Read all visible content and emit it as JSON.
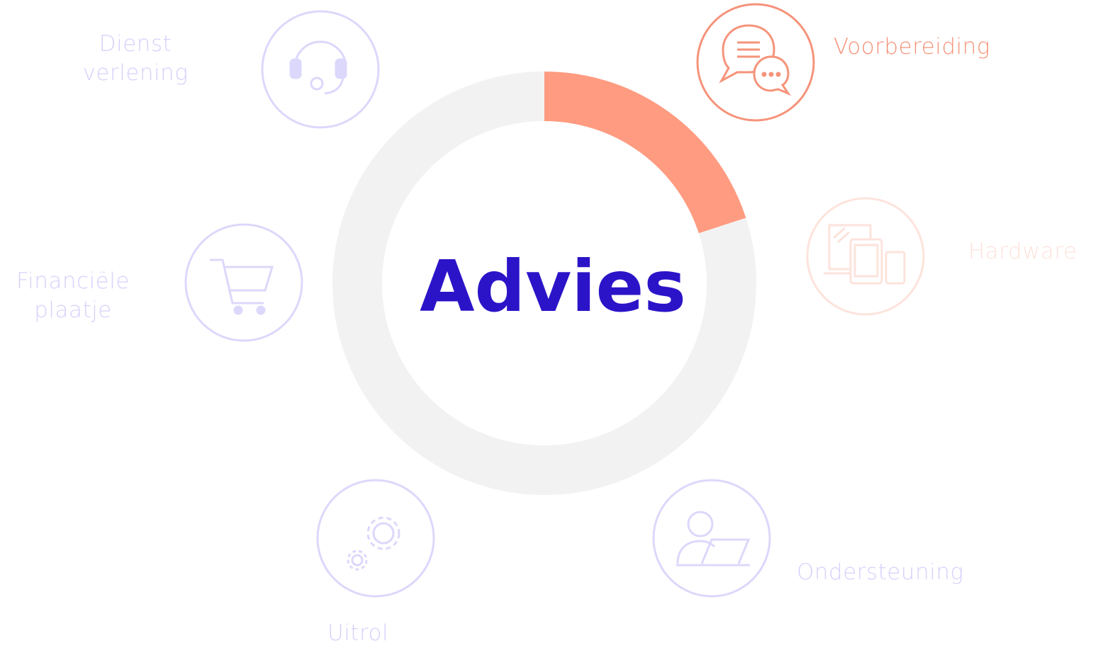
{
  "center": {
    "title": "Advies"
  },
  "nodes": [
    {
      "id": "dienstverlening",
      "label_lines": [
        "Dienst",
        "verlening"
      ],
      "icon": "headset-icon",
      "state": "inactive"
    },
    {
      "id": "voorbereiding",
      "label_lines": [
        "Voorbereiding"
      ],
      "icon": "chat-bubbles-icon",
      "state": "active"
    },
    {
      "id": "hardware",
      "label_lines": [
        "Hardware"
      ],
      "icon": "devices-icon",
      "state": "faded"
    },
    {
      "id": "financiele-plaatje",
      "label_lines": [
        "Financiële",
        "plaatje"
      ],
      "icon": "shopping-cart-icon",
      "state": "inactive"
    },
    {
      "id": "uitrol",
      "label_lines": [
        "Uitrol"
      ],
      "icon": "gears-icon",
      "state": "inactive"
    },
    {
      "id": "ondersteuning",
      "label_lines": [
        "Ondersteuning"
      ],
      "icon": "user-laptop-icon",
      "state": "inactive"
    }
  ],
  "ring": {
    "progress_fraction": 0.2,
    "track_color": "#f2f2f2",
    "fill_color": "#ff9b80"
  },
  "colors": {
    "accent": "#2b14c8",
    "active": "#f5937a",
    "inactive": "#dcd8fb",
    "inactive_text": "#d6d1fb",
    "faded": "#fde3dc"
  }
}
